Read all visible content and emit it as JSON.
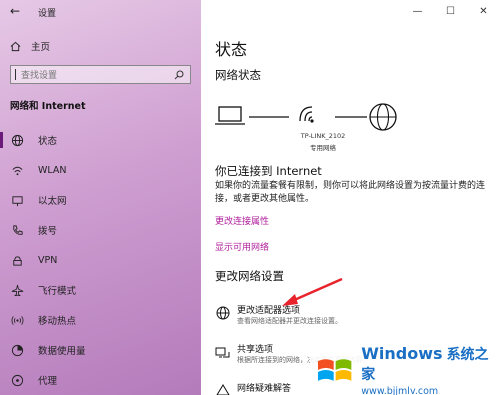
{
  "app": {
    "back_icon": "back-arrow-icon",
    "title": "设置"
  },
  "window": {
    "minimize": "—",
    "maximize": "☐",
    "close": "✕"
  },
  "sidebar": {
    "home_label": "主页",
    "search_placeholder": "查找设置",
    "section_title": "网络和 Internet",
    "items": [
      {
        "label": "状态",
        "icon": "globe-icon",
        "active": true
      },
      {
        "label": "WLAN",
        "icon": "wifi-icon"
      },
      {
        "label": "以太网",
        "icon": "ethernet-icon"
      },
      {
        "label": "拨号",
        "icon": "phone-icon"
      },
      {
        "label": "VPN",
        "icon": "vpn-icon"
      },
      {
        "label": "飞行模式",
        "icon": "airplane-icon"
      },
      {
        "label": "移动热点",
        "icon": "hotspot-icon"
      },
      {
        "label": "数据使用量",
        "icon": "data-usage-icon"
      },
      {
        "label": "代理",
        "icon": "proxy-icon"
      }
    ],
    "accent_color": "#6b1a7a"
  },
  "main": {
    "title": "状态",
    "network_status": "网络状态",
    "ssid": "TP-LINK_2102",
    "network_type": "专用网络",
    "connected": "你已连接到 Internet",
    "description": "如果你的流量套餐有限制，则你可以将此网络设置为按流量计费的连接，或者更改其他属性。",
    "link_change_props": "更改连接属性",
    "link_show_networks": "显示可用网络",
    "change_heading": "更改网络设置",
    "link_color": "#b0209c",
    "options": [
      {
        "title": "更改适配器选项",
        "subtitle": "查看网络适配器并更改连接设置。",
        "icon": "adapter-globe-icon"
      },
      {
        "title": "共享选项",
        "subtitle": "根据所连接到的网络，决定要共享的内容。",
        "icon": "sharing-icon"
      },
      {
        "title": "网络疑难解答",
        "subtitle": "",
        "icon": "troubleshoot-icon"
      }
    ]
  },
  "watermark": {
    "brand": "Windows",
    "cn": "系统之家",
    "url": "www.bjjmlv.com"
  }
}
